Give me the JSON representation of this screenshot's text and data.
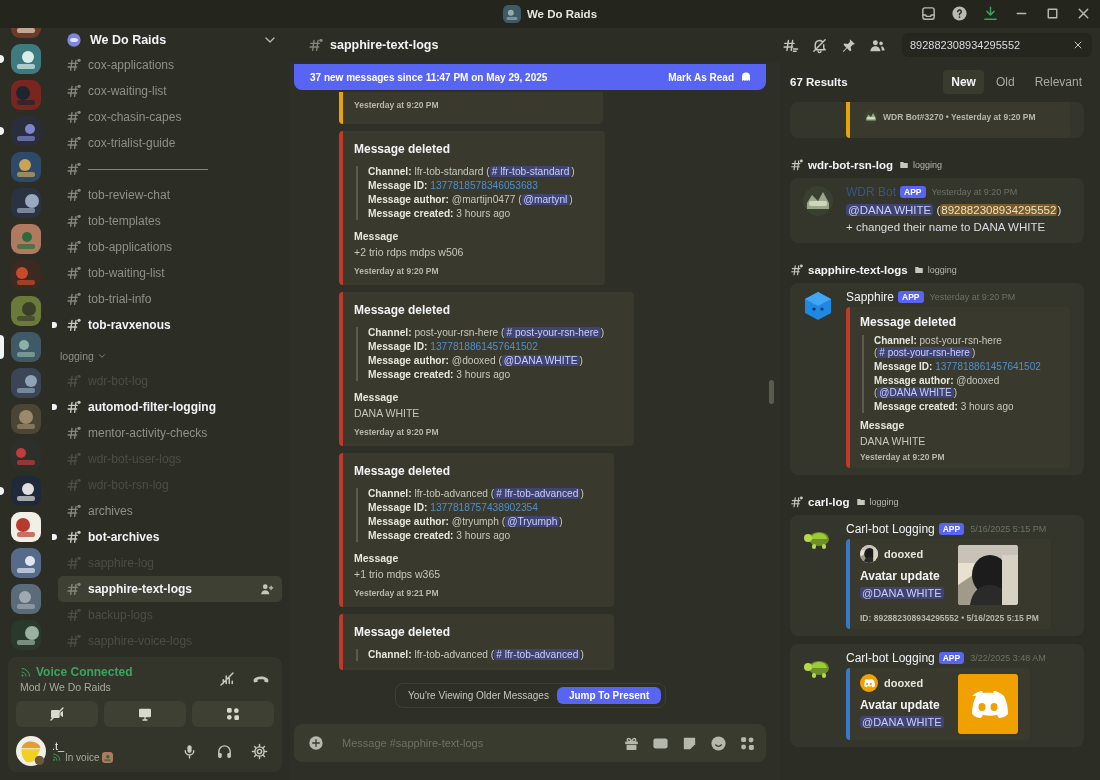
{
  "window": {
    "title": "We Do Raids"
  },
  "servers": [
    {
      "selected": false,
      "unread": false
    },
    {
      "selected": false,
      "unread": true
    },
    {
      "selected": false,
      "unread": false
    },
    {
      "selected": false,
      "unread": true
    },
    {
      "selected": false,
      "unread": false
    },
    {
      "selected": false,
      "unread": false
    },
    {
      "selected": false,
      "unread": false
    },
    {
      "selected": false,
      "unread": false
    },
    {
      "selected": false,
      "unread": false
    },
    {
      "selected": true,
      "unread": false
    },
    {
      "selected": false,
      "unread": false
    },
    {
      "selected": false,
      "unread": false
    },
    {
      "selected": false,
      "unread": false
    },
    {
      "selected": false,
      "unread": true
    },
    {
      "selected": false,
      "unread": false
    },
    {
      "selected": false,
      "unread": false
    },
    {
      "selected": false,
      "unread": false
    },
    {
      "selected": false,
      "unread": false
    }
  ],
  "sidebar": {
    "server_name": "We Do Raids",
    "items": [
      {
        "kind": "channel",
        "name": "cox-applications",
        "unread": false,
        "muted": false,
        "selected": false
      },
      {
        "kind": "channel",
        "name": "cox-waiting-list",
        "unread": false,
        "muted": false,
        "selected": false
      },
      {
        "kind": "channel",
        "name": "cox-chasin-capes",
        "unread": false,
        "muted": false,
        "selected": false
      },
      {
        "kind": "channel",
        "name": "cox-trialist-guide",
        "unread": false,
        "muted": false,
        "selected": false
      },
      {
        "kind": "channel",
        "name": "——————————",
        "unread": false,
        "muted": false,
        "selected": false
      },
      {
        "kind": "channel",
        "name": "tob-review-chat",
        "unread": false,
        "muted": false,
        "selected": false
      },
      {
        "kind": "channel",
        "name": "tob-templates",
        "unread": false,
        "muted": false,
        "selected": false
      },
      {
        "kind": "channel",
        "name": "tob-applications",
        "unread": false,
        "muted": false,
        "selected": false
      },
      {
        "kind": "channel",
        "name": "tob-waiting-list",
        "unread": false,
        "muted": false,
        "selected": false
      },
      {
        "kind": "channel",
        "name": "tob-trial-info",
        "unread": false,
        "muted": false,
        "selected": false
      },
      {
        "kind": "channel",
        "name": "tob-ravxenous",
        "unread": true,
        "muted": false,
        "selected": false
      },
      {
        "kind": "category",
        "name": "logging",
        "expanded": true
      },
      {
        "kind": "channel",
        "name": "wdr-bot-log",
        "unread": false,
        "muted": true,
        "selected": false
      },
      {
        "kind": "channel",
        "name": "automod-filter-logging",
        "unread": true,
        "muted": false,
        "selected": false
      },
      {
        "kind": "channel",
        "name": "mentor-activity-checks",
        "unread": false,
        "muted": false,
        "selected": false
      },
      {
        "kind": "channel",
        "name": "wdr-bot-user-logs",
        "unread": false,
        "muted": true,
        "selected": false
      },
      {
        "kind": "channel",
        "name": "wdr-bot-rsn-log",
        "unread": false,
        "muted": true,
        "selected": false
      },
      {
        "kind": "channel",
        "name": "archives",
        "unread": false,
        "muted": false,
        "selected": false
      },
      {
        "kind": "channel",
        "name": "bot-archives",
        "unread": true,
        "muted": false,
        "selected": false
      },
      {
        "kind": "channel",
        "name": "sapphire-log",
        "unread": false,
        "muted": true,
        "selected": false
      },
      {
        "kind": "channel",
        "name": "sapphire-text-logs",
        "unread": false,
        "muted": false,
        "selected": true
      },
      {
        "kind": "channel",
        "name": "backup-logs",
        "unread": false,
        "muted": true,
        "selected": false
      },
      {
        "kind": "channel",
        "name": "sapphire-voice-logs",
        "unread": false,
        "muted": true,
        "selected": false
      }
    ]
  },
  "voice": {
    "status": "Voice Connected",
    "location": "Mod / We Do Raids"
  },
  "user": {
    "name": ".t_",
    "status": "In voice"
  },
  "chat": {
    "channel": "sapphire-text-logs",
    "banner": {
      "text": "37 new messages since 11:47 PM on May 29, 2025",
      "action": "Mark As Read"
    },
    "messages": [
      {
        "kind": "log",
        "color": "#e5a50a",
        "footer": "Yesterday at 9:20 PM"
      },
      {
        "kind": "log",
        "color": "#c0392b",
        "title": "Message deleted",
        "fields": [
          [
            {
              "kind": "label",
              "text": "Channel:"
            },
            {
              "kind": "text",
              "text": " lfr-tob-standard ("
            },
            {
              "kind": "mention",
              "text": "# lfr-tob-standard"
            },
            {
              "kind": "text",
              "text": ")"
            }
          ],
          [
            {
              "kind": "label",
              "text": "Message ID:"
            },
            {
              "kind": "link",
              "text": "1377818578346053683"
            }
          ],
          [
            {
              "kind": "label",
              "text": "Message author:"
            },
            {
              "kind": "text",
              "text": " @martijn0477 ("
            },
            {
              "kind": "mention",
              "text": "@martynl"
            },
            {
              "kind": "text",
              "text": ")"
            }
          ],
          [
            {
              "kind": "label",
              "text": "Message created:"
            },
            {
              "kind": "text",
              "text": " 3 hours ago"
            }
          ]
        ],
        "section_title": "Message",
        "section_text": "+2 trio rdps mdps w506",
        "footer": "Yesterday at 9:20 PM"
      },
      {
        "kind": "log",
        "color": "#c0392b",
        "title": "Message deleted",
        "fields": [
          [
            {
              "kind": "label",
              "text": "Channel:"
            },
            {
              "kind": "text",
              "text": " post-your-rsn-here ("
            },
            {
              "kind": "mention",
              "text": "# post-your-rsn-here"
            },
            {
              "kind": "text",
              "text": ")"
            }
          ],
          [
            {
              "kind": "label",
              "text": "Message ID:"
            },
            {
              "kind": "link",
              "text": "1377818861457641502"
            }
          ],
          [
            {
              "kind": "label",
              "text": "Message author:"
            },
            {
              "kind": "text",
              "text": " @dooxed ("
            },
            {
              "kind": "mention",
              "text": "@DANA WHITE"
            },
            {
              "kind": "text",
              "text": ")"
            }
          ],
          [
            {
              "kind": "label",
              "text": "Message created:"
            },
            {
              "kind": "text",
              "text": " 3 hours ago"
            }
          ]
        ],
        "section_title": "Message",
        "section_text": "DANA WHITE",
        "footer": "Yesterday at 9:20 PM"
      },
      {
        "kind": "log",
        "color": "#c0392b",
        "title": "Message deleted",
        "fields": [
          [
            {
              "kind": "label",
              "text": "Channel:"
            },
            {
              "kind": "text",
              "text": " lfr-tob-advanced ("
            },
            {
              "kind": "mention",
              "text": "# lfr-tob-advanced"
            },
            {
              "kind": "text",
              "text": ")"
            }
          ],
          [
            {
              "kind": "label",
              "text": "Message ID:"
            },
            {
              "kind": "link",
              "text": "1377818757438902354"
            }
          ],
          [
            {
              "kind": "label",
              "text": "Message author:"
            },
            {
              "kind": "text",
              "text": " @tryumph ("
            },
            {
              "kind": "mention",
              "text": "@Tryumph"
            },
            {
              "kind": "text",
              "text": ")"
            }
          ],
          [
            {
              "kind": "label",
              "text": "Message created:"
            },
            {
              "kind": "text",
              "text": " 3 hours ago"
            }
          ]
        ],
        "section_title": "Message",
        "section_text": "+1 trio mdps w365",
        "footer": "Yesterday at 9:21 PM"
      },
      {
        "kind": "log",
        "color": "#c0392b",
        "title": "Message deleted",
        "fields": [
          [
            {
              "kind": "label",
              "text": "Channel:"
            },
            {
              "kind": "text",
              "text": " lfr-tob-advanced ("
            },
            {
              "kind": "mention",
              "text": "# lfr-tob-advanced"
            },
            {
              "kind": "text",
              "text": ")"
            }
          ]
        ]
      }
    ],
    "older_notice": {
      "text": "You're Viewing Older Messages",
      "action": "Jump To Present"
    },
    "composer": {
      "placeholder": "Message #sapphire-text-logs"
    }
  },
  "search": {
    "value": "892882308934295552",
    "count": "67 Results",
    "sorts": [
      {
        "label": "New",
        "selected": true
      },
      {
        "label": "Old",
        "selected": false
      },
      {
        "label": "Relevant",
        "selected": false
      }
    ],
    "results": [
      {
        "kind": "footer-card",
        "color": "#e5a50a",
        "footer": "WDR Bot#3270 • Yesterday at 9:20 PM"
      },
      {
        "kind": "channel-header",
        "channel": "wdr-bot-rsn-log",
        "category": "logging"
      },
      {
        "kind": "message",
        "avatar": {
          "kind": "mosaic"
        },
        "author": "WDR Bot",
        "color": "#34568a",
        "badge": "APP",
        "time": "Yesterday at 9:20 PM",
        "content": [
          {
            "kind": "mention",
            "text": "@DANA WHITE"
          },
          {
            "kind": "text",
            "text": " ("
          },
          {
            "kind": "highlight",
            "text": "892882308934295552"
          },
          {
            "kind": "text",
            "text": ") + changed their name to DANA WHITE"
          }
        ]
      },
      {
        "kind": "channel-header",
        "channel": "sapphire-text-logs",
        "category": "logging"
      },
      {
        "kind": "message",
        "avatar": {
          "kind": "hexagon"
        },
        "author": "Sapphire",
        "color": "#f2f3f5",
        "badge": "APP",
        "time": "Yesterday at 9:20 PM",
        "embed": {
          "kind": "log",
          "color": "#c0392b",
          "title": "Message deleted",
          "fields": [
            [
              {
                "kind": "label",
                "text": "Channel:"
              },
              {
                "kind": "text",
                "text": " post-your-rsn-here ("
              },
              {
                "kind": "mention",
                "text": "# post-your-rsn-here"
              },
              {
                "kind": "text",
                "text": ")"
              }
            ],
            [
              {
                "kind": "label",
                "text": "Message ID:"
              },
              {
                "kind": "link",
                "text": "1377818861457641502"
              }
            ],
            [
              {
                "kind": "label",
                "text": "Message author:"
              },
              {
                "kind": "text",
                "text": " @dooxed ("
              },
              {
                "kind": "mention",
                "text": "@DANA WHITE"
              },
              {
                "kind": "text",
                "text": ")"
              }
            ],
            [
              {
                "kind": "label",
                "text": "Message created:"
              },
              {
                "kind": "text",
                "text": " 3 hours ago"
              }
            ]
          ],
          "section_title": "Message",
          "section_text": "DANA WHITE",
          "footer": "Yesterday at 9:20 PM"
        }
      },
      {
        "kind": "channel-header",
        "channel": "carl-log",
        "category": "logging"
      },
      {
        "kind": "message",
        "avatar": {
          "kind": "turtle"
        },
        "author": "Carl-bot Logging",
        "color": "#f2f3f5",
        "badge": "APP",
        "time": "5/16/2025 5:15 PM",
        "embed": {
          "kind": "avatar",
          "color": "#3a78c8",
          "author": "dooxed",
          "title": "Avatar update",
          "mention": "@DANA WHITE",
          "footer": "ID: 892882308934295552 • 5/16/2025 5:15 PM"
        }
      },
      {
        "kind": "message",
        "avatar": {
          "kind": "turtle"
        },
        "author": "Carl-bot Logging",
        "color": "#f2f3f5",
        "badge": "APP",
        "time": "3/22/2025 3:48 AM",
        "embed": {
          "kind": "avatar",
          "color": "#3a78c8",
          "picture": {
            "kind": "logo"
          },
          "author": "dooxed",
          "title": "Avatar update",
          "mention": "@DANA WHITE"
        }
      }
    ]
  }
}
